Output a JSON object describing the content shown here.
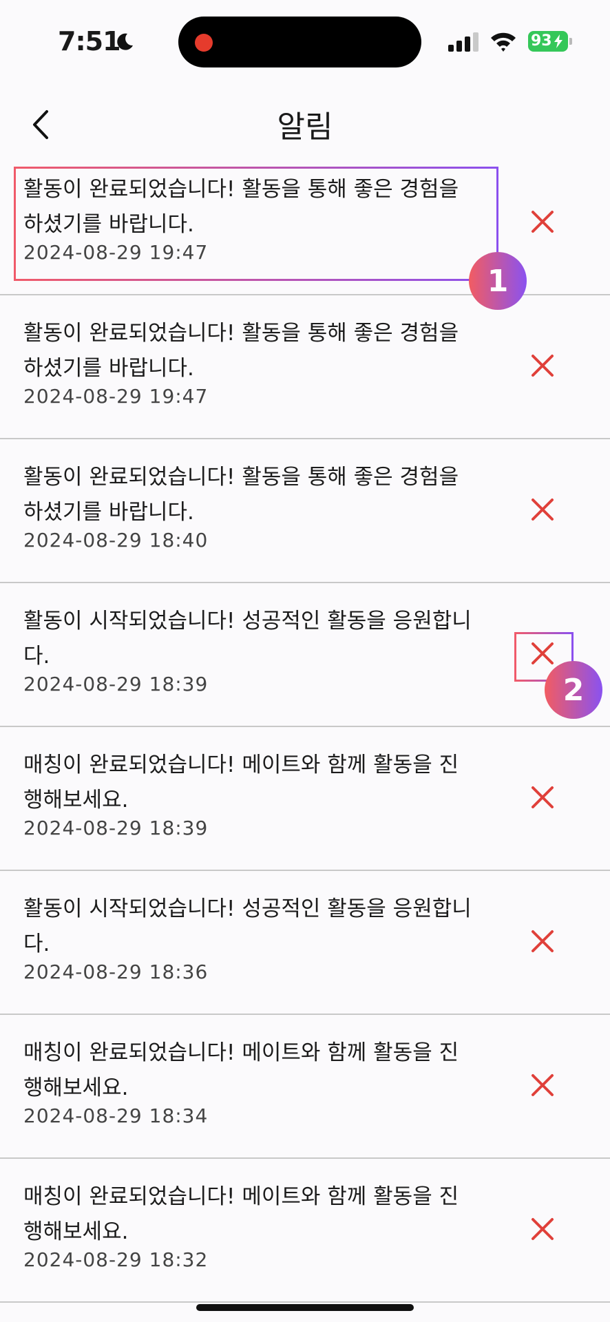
{
  "status_bar": {
    "time": "7:51",
    "battery": "93"
  },
  "header": {
    "title": "알림"
  },
  "notifications": [
    {
      "text": "활동이 완료되었습니다! 활동을 통해 좋은 경험을 하셨기를 바랍니다.",
      "date": "2024-08-29 19:47"
    },
    {
      "text": "활동이 완료되었습니다! 활동을 통해 좋은 경험을 하셨기를 바랍니다.",
      "date": "2024-08-29 19:47"
    },
    {
      "text": "활동이 완료되었습니다! 활동을 통해 좋은 경험을 하셨기를 바랍니다.",
      "date": "2024-08-29 18:40"
    },
    {
      "text": "활동이 시작되었습니다! 성공적인 활동을 응원합니다.",
      "date": "2024-08-29 18:39"
    },
    {
      "text": "매칭이 완료되었습니다! 메이트와 함께 활동을 진행해보세요.",
      "date": "2024-08-29 18:39"
    },
    {
      "text": "활동이 시작되었습니다! 성공적인 활동을 응원합니다.",
      "date": "2024-08-29 18:36"
    },
    {
      "text": "매칭이 완료되었습니다! 메이트와 함께 활동을 진행해보세요.",
      "date": "2024-08-29 18:34"
    },
    {
      "text": "매칭이 완료되었습니다! 메이트와 함께 활동을 진행해보세요.",
      "date": "2024-08-29 18:32"
    }
  ],
  "annotations": {
    "badge_1": "1",
    "badge_2": "2"
  },
  "colors": {
    "delete_icon": "#e0403a",
    "battery": "#35c759",
    "annotation_start": "#f05a6a",
    "annotation_end": "#8b50ee"
  }
}
